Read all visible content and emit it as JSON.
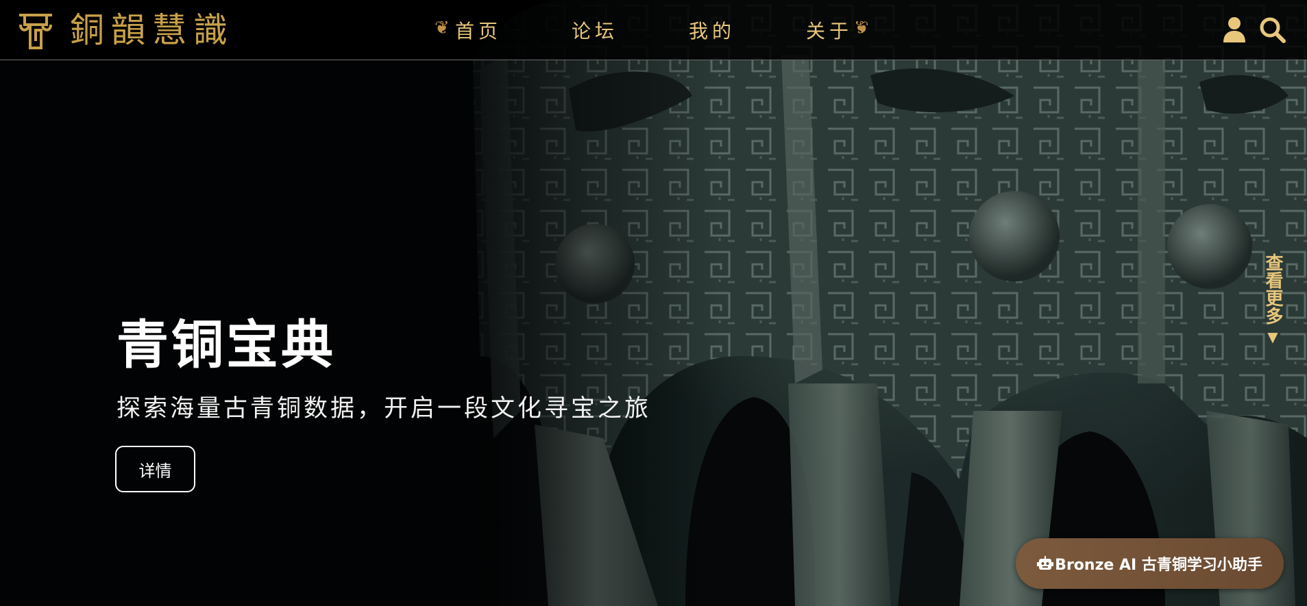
{
  "header": {
    "logo_text": "銅韻慧識",
    "nav": [
      {
        "label": "首页"
      },
      {
        "label": "论坛"
      },
      {
        "label": "我的"
      },
      {
        "label": "关于"
      }
    ],
    "icons": [
      "logo-mark-icon",
      "user-icon",
      "search-icon"
    ],
    "colors": {
      "gold": "#e8c67c",
      "logo_gold": "#c9a14a"
    }
  },
  "hero": {
    "title": "青铜宝典",
    "subtitle": "探索海量古青铜数据，开启一段文化寻宝之旅",
    "detail_button": "详情",
    "see_more": "查看更多",
    "see_more_arrow": "▼"
  },
  "assistant": {
    "label": "Bronze AI 古青铜学习小助手",
    "icon": "robot-icon",
    "color": "#7c5a3d"
  }
}
